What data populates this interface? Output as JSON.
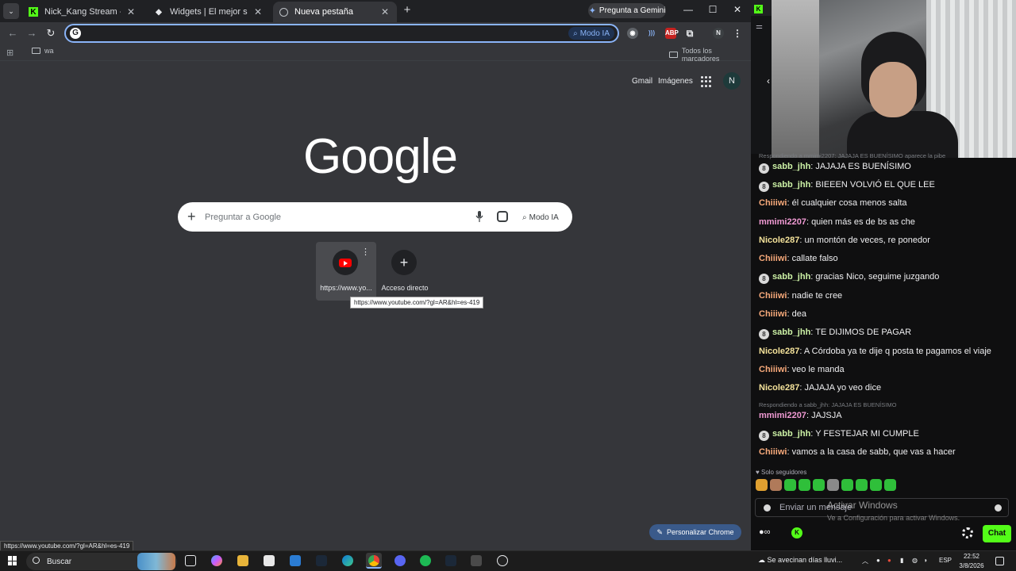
{
  "tabs": [
    {
      "title": "Nick_Kang Stream - Watch Live",
      "icon": "kick-icon",
      "color": "#53fc18"
    },
    {
      "title": "Widgets | El mejor software para",
      "icon": "widgets-icon",
      "color": "#e8eaed"
    },
    {
      "title": "Nueva pestaña",
      "icon": "globe-icon",
      "color": "#e8eaed"
    }
  ],
  "gemini_button": "Pregunta a Gemini",
  "omnibox": {
    "value": "",
    "modo_ia": "Modo IA"
  },
  "profile_initial": "N",
  "bookmarks": {
    "folder": "wa",
    "all": "Todos los marcadores"
  },
  "ntp": {
    "gmail": "Gmail",
    "images": "Imágenes",
    "logo": "Google",
    "search_placeholder": "Preguntar a Google",
    "modo_ia": "Modo IA",
    "shortcuts": [
      {
        "label": "https://www.yo...",
        "icon": "youtube-icon"
      },
      {
        "label": "Acceso directo",
        "icon": "plus-icon"
      }
    ],
    "tooltip": "https://www.youtube.com/?gl=AR&hl=es-419",
    "customize": "Personalizar Chrome",
    "status_url": "https://www.youtube.com/?gl=AR&hl=es-419"
  },
  "chat": {
    "reply_hints": [
      "Respondiendo a mmimi2207: JAJAJA ES BUENÍSIMO aparece la pibe",
      "Respondiendo a sabb_jhh: JAJAJA ES BUENÍSIMO"
    ],
    "messages": [
      {
        "user": "sabb_jhh",
        "text": "JAJAJA ES BUENÍSIMO",
        "badge": "8",
        "color": "#cdf2a6"
      },
      {
        "user": "sabb_jhh",
        "text": "BIEEEN VOLVIÓ EL QUE LEE",
        "badge": "8",
        "color": "#cdf2a6"
      },
      {
        "user": "Chiiiwi",
        "text": "él cualquier cosa menos salta",
        "badge": "",
        "color": "#f7a97a"
      },
      {
        "user": "mmimi2207",
        "text": "quien más es de bs as che",
        "badge": "",
        "color": "#f09ad3"
      },
      {
        "user": "Nicole287",
        "text": "un montón de veces, re ponedor",
        "badge": "",
        "color": "#f4e29a"
      },
      {
        "user": "Chiiiwi",
        "text": "callate falso",
        "badge": "",
        "color": "#f7a97a"
      },
      {
        "user": "sabb_jhh",
        "text": "gracias Nico, seguime juzgando",
        "badge": "8",
        "color": "#cdf2a6"
      },
      {
        "user": "Chiiiwi",
        "text": "nadie te cree",
        "badge": "",
        "color": "#f7a97a"
      },
      {
        "user": "Chiiiwi",
        "text": "dea",
        "badge": "",
        "color": "#f7a97a"
      },
      {
        "user": "sabb_jhh",
        "text": "TE DIJIMOS DE PAGAR",
        "badge": "8",
        "color": "#cdf2a6"
      },
      {
        "user": "Nicole287",
        "text": "A Córdoba ya te dije q posta te pagamos el viaje",
        "badge": "",
        "color": "#f4e29a"
      },
      {
        "user": "Chiiiwi",
        "text": "veo le manda",
        "badge": "",
        "color": "#f7a97a"
      },
      {
        "user": "Nicole287",
        "text": "JAJAJA yo veo dice",
        "badge": "",
        "color": "#f4e29a"
      },
      {
        "user": "mmimi2207",
        "text": "JAJSJA",
        "badge": "",
        "color": "#f09ad3"
      },
      {
        "user": "sabb_jhh",
        "text": "Y FESTEJAR MI CUMPLE",
        "badge": "8",
        "color": "#cdf2a6"
      },
      {
        "user": "Chiiiwi",
        "text": "vamos a la casa de sabb, que vas a hacer",
        "badge": "",
        "color": "#f7a97a"
      }
    ],
    "followers_only": "Solo seguidores",
    "input_placeholder": "Enviar un mensaje",
    "chat_button": "Chat"
  },
  "activation": {
    "title": "Activar Windows",
    "subtitle": "Ve a Configuración para activar Windows."
  },
  "taskbar": {
    "search": "Buscar",
    "weather": "Se avecinan días lluvi...",
    "lang": "ESP",
    "time": "22:52",
    "date": "3/8/2026"
  }
}
